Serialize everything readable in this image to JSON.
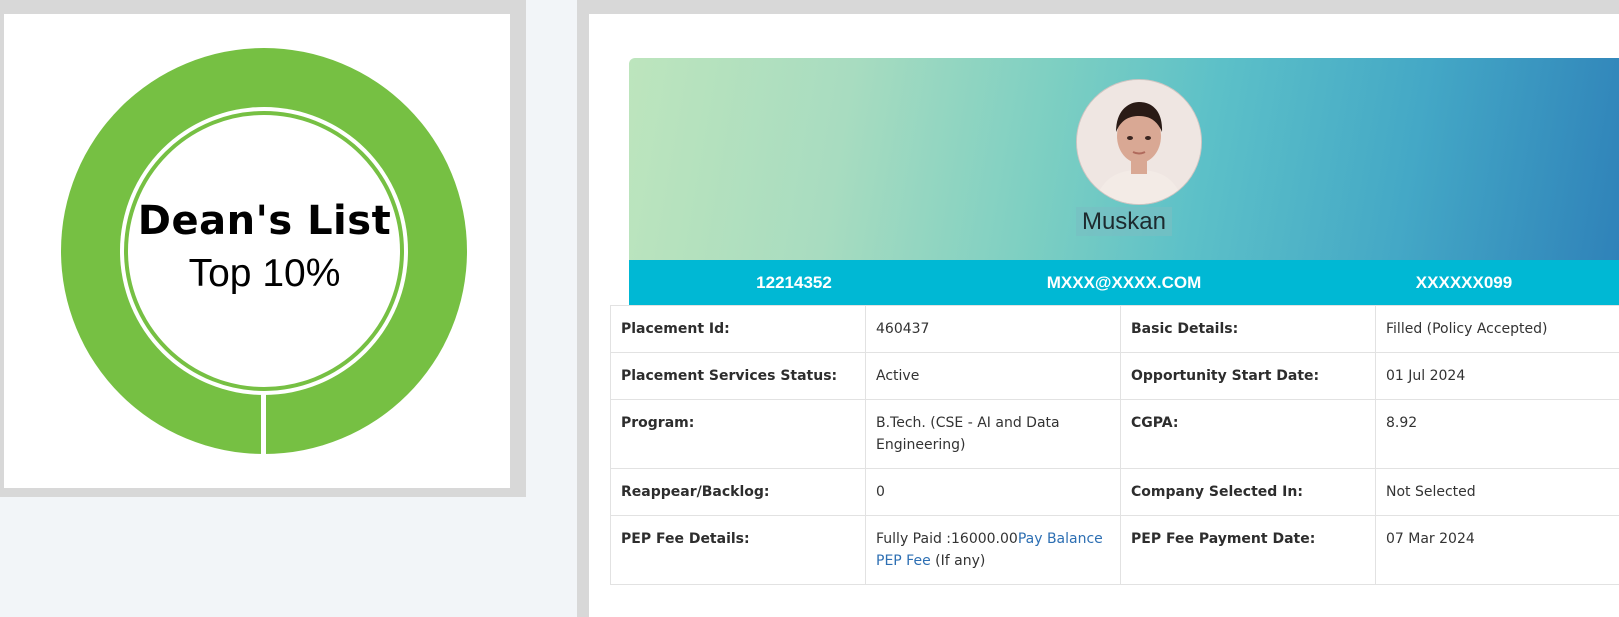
{
  "badge": {
    "title": "Dean's List",
    "subtitle": "Top 10%",
    "ring_color": "#76c043"
  },
  "profile": {
    "name": "Muskan",
    "avatar_icon": "student-photo",
    "strip": {
      "reg_no": "12214352",
      "email": "MXXX@XXXX.COM",
      "phone": "XXXXXX099"
    },
    "strip_color": "#00b8d4"
  },
  "details": {
    "rows": [
      {
        "l1": "Placement Id:",
        "v1": "460437",
        "l2": "Basic Details:",
        "v2": "Filled (Policy Accepted)"
      },
      {
        "l1": "Placement Services Status:",
        "v1": "Active",
        "l2": "Opportunity Start Date:",
        "v2": "01 Jul 2024"
      },
      {
        "l1": "Program:",
        "v1": "B.Tech. (CSE - AI and Data Engineering)",
        "l2": "CGPA:",
        "v2": "8.92"
      },
      {
        "l1": "Reappear/Backlog:",
        "v1": "0",
        "l2": "Company Selected In:",
        "v2": "Not Selected"
      }
    ],
    "pep": {
      "label": "PEP Fee Details:",
      "paid_text": "Fully Paid :16000.00",
      "link_text": "Pay Balance PEP Fee",
      "suffix": " (If any)",
      "date_label": "PEP Fee Payment Date:",
      "date_value": "07 Mar 2024"
    }
  }
}
